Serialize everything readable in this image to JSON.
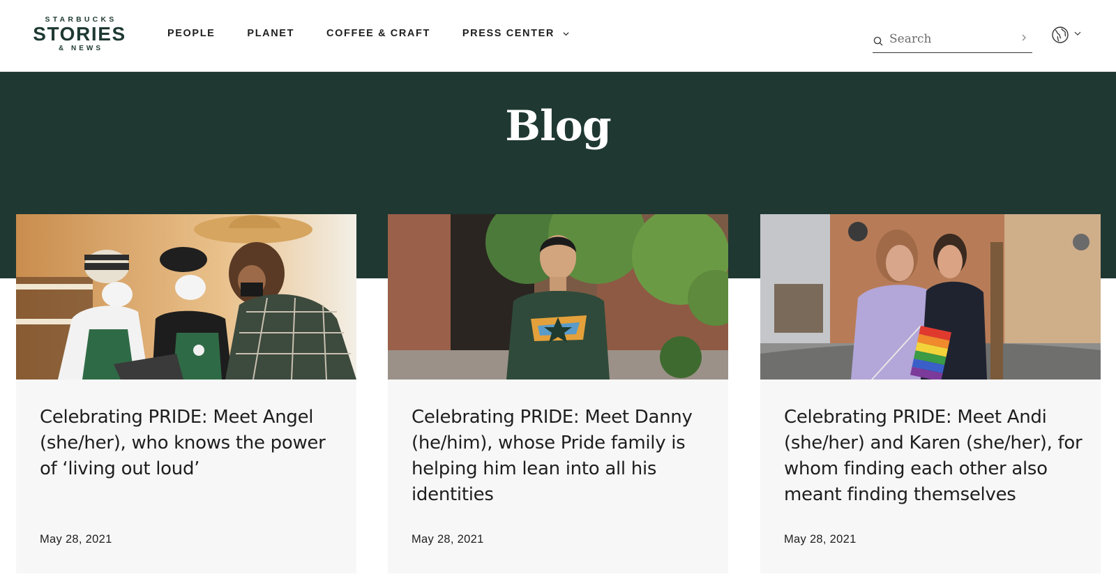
{
  "brand": {
    "top": "STARBUCKS",
    "name": "STORIES",
    "sub": "& NEWS"
  },
  "nav": {
    "items": [
      {
        "label": "PEOPLE"
      },
      {
        "label": "PLANET"
      },
      {
        "label": "COFFEE & CRAFT"
      },
      {
        "label": "PRESS CENTER"
      }
    ]
  },
  "search": {
    "placeholder": "Search"
  },
  "icons": {
    "search": "search-icon",
    "submit": "chevron-right-icon",
    "language": "globe-icon",
    "dropdown": "chevron-down-icon"
  },
  "hero": {
    "title": "Blog"
  },
  "colors": {
    "brand_green": "#1f3832",
    "card_bg": "#f7f7f7",
    "text": "#1e1e1e"
  },
  "cards": [
    {
      "title": "Celebrating PRIDE: Meet Angel (she/her), who knows the power of ‘living out loud’",
      "date": "May 28, 2021"
    },
    {
      "title": "Celebrating PRIDE: Meet Danny (he/him), whose Pride family is helping him lean into all his identities",
      "date": "May 28, 2021"
    },
    {
      "title": "Celebrating PRIDE: Meet Andi (she/her) and Karen (she/her), for whom finding each other also meant finding themselves",
      "date": "May 28, 2021"
    }
  ]
}
